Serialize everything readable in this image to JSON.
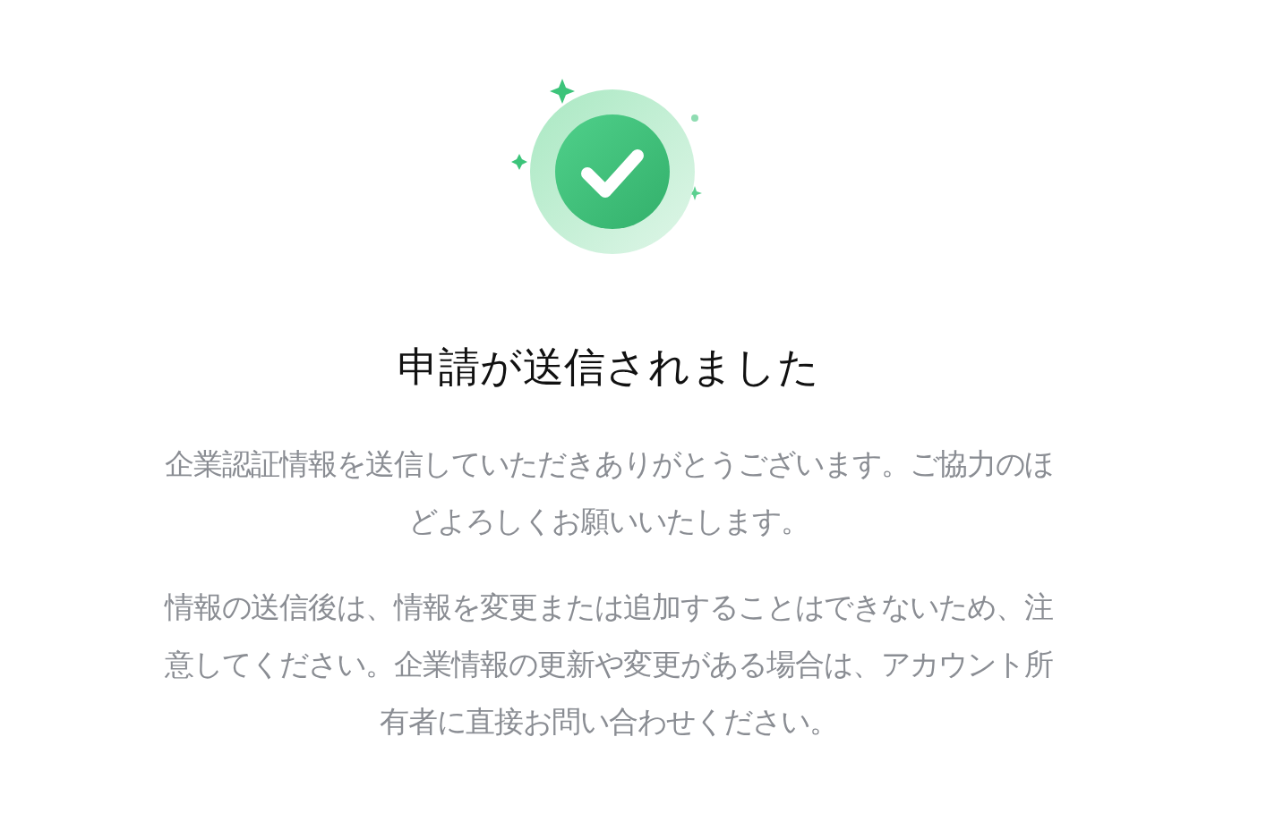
{
  "title": "申請が送信されました",
  "paragraphs": [
    "企業認証情報を送信していただきありがとうございます。ご協力のほどよろしくお願いいたします。",
    "情報の送信後は、情報を変更または追加することはできないため、注意してください。企業情報の更新や変更がある場合は、アカウント所有者に直接お問い合わせください。"
  ]
}
